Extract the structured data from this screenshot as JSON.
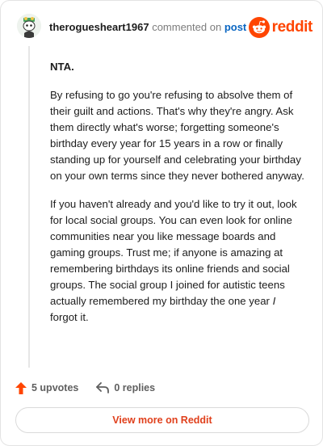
{
  "header": {
    "username": "theroguesheart1967",
    "action_text": "commented on",
    "post_link": "post",
    "brand": "reddit"
  },
  "comment": {
    "paragraphs": [
      "NTA.",
      "By refusing to go you're refusing to absolve them of their guilt and actions. That's why they're angry. Ask them directly what's worse; forgetting someone's birthday every year for 15 years in a row or finally standing up for yourself and celebrating your birthday on your own terms since they never bothered anyway.",
      "If you haven't already and you'd like to try it out, look for local social groups. You can even look for online communities near you like message boards and gaming groups. Trust me; if anyone is amazing at remembering birthdays its online friends and social groups. The social group I joined for autistic teens actually remembered my birthday the one year ",
      "I",
      " forgot it."
    ]
  },
  "actions": {
    "upvotes": "5 upvotes",
    "replies": "0 replies"
  },
  "footer": {
    "view_more": "View more on Reddit"
  },
  "colors": {
    "brand": "#ff4500",
    "upvote": "#ff4500",
    "link": "#0a66c2"
  }
}
